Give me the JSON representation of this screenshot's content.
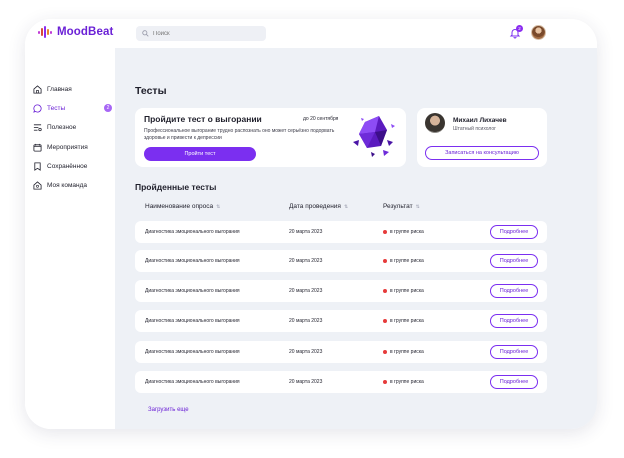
{
  "app": {
    "name": "MoodBeat"
  },
  "search": {
    "placeholder": "Поиск"
  },
  "notifications": {
    "count": "2"
  },
  "sidebar": {
    "items": [
      {
        "label": "Главная",
        "icon": "home-icon"
      },
      {
        "label": "Тесты",
        "icon": "chat-icon",
        "badge": "2",
        "active": true
      },
      {
        "label": "Полезное",
        "icon": "filter-icon"
      },
      {
        "label": "Мероприятия",
        "icon": "calendar-icon"
      },
      {
        "label": "Сохранённое",
        "icon": "bookmark-icon"
      },
      {
        "label": "Моя команда",
        "icon": "team-icon"
      }
    ]
  },
  "page": {
    "title": "Тесты"
  },
  "promo": {
    "title": "Пройдите тест о выгорании",
    "deadline": "до 20 сентября",
    "description": "Профессиональное выгорание трудно распознать оно может серьёзно подорвать здоровье и привести к депрессии",
    "button": "Пройти тест"
  },
  "psychologist": {
    "name": "Михаил Лихачев",
    "role": "Штатный психолог",
    "button": "Записаться на консультацию"
  },
  "completed": {
    "title": "Пройденные тесты",
    "columns": [
      "Наименование опроса",
      "Дата проведения",
      "Результат"
    ],
    "rows": [
      {
        "name": "Диагностика эмоционального выгорания",
        "date": "20 марта 2023",
        "result": "в группе риска",
        "action": "Подробнее"
      },
      {
        "name": "Диагностика эмоционального выгорания",
        "date": "20 марта 2023",
        "result": "в группе риска",
        "action": "Подробнее"
      },
      {
        "name": "Диагностика эмоционального выгорания",
        "date": "20 марта 2023",
        "result": "в группе риска",
        "action": "Подробнее"
      },
      {
        "name": "Диагностика эмоционального выгорания",
        "date": "20 марта 2023",
        "result": "в группе риска",
        "action": "Подробнее"
      },
      {
        "name": "Диагностика эмоционального выгорания",
        "date": "20 марта 2023",
        "result": "в группе риска",
        "action": "Подробнее"
      },
      {
        "name": "Диагностика эмоционального выгорания",
        "date": "20 марта 2023",
        "result": "в группе риска",
        "action": "Подробнее"
      }
    ],
    "load_more": "Загрузить еще"
  },
  "colors": {
    "accent": "#7b2ff0",
    "risk": "#e63b3b",
    "background": "#eef1f6"
  }
}
